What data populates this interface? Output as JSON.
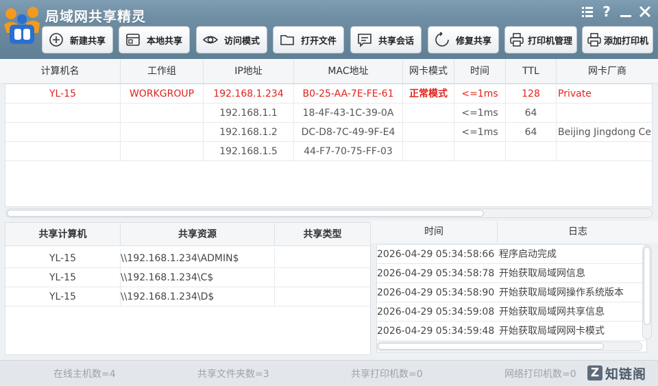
{
  "app": {
    "title": "局域网共享精灵"
  },
  "window_controls": [
    "menu-icon",
    "help-icon",
    "minimize-icon",
    "close-icon"
  ],
  "toolbar": [
    {
      "label": "新建共享",
      "icon": "plus-circle-icon"
    },
    {
      "label": "本地共享",
      "icon": "window-icon"
    },
    {
      "label": "访问模式",
      "icon": "eye-icon"
    },
    {
      "label": "打开文件",
      "icon": "folder-icon"
    },
    {
      "label": "共享会话",
      "icon": "chat-icon"
    },
    {
      "label": "修复共享",
      "icon": "refresh-icon"
    },
    {
      "label": "打印机管理",
      "icon": "printer-icon"
    },
    {
      "label": "添加打印机",
      "icon": "printer-add-icon"
    }
  ],
  "hosts_table": {
    "headers": [
      "计算机名",
      "工作组",
      "IP地址",
      "MAC地址",
      "网卡模式",
      "时间",
      "TTL",
      "网卡厂商"
    ],
    "rows": [
      {
        "computer": "YL-15",
        "workgroup": "WORKGROUP",
        "ip": "192.168.1.234",
        "mac": "B0-25-AA-7E-FE-61",
        "mode": "正常模式",
        "time": "<=1ms",
        "ttl": "128",
        "vendor": "Private",
        "highlight": true
      },
      {
        "computer": "",
        "workgroup": "",
        "ip": "192.168.1.1",
        "mac": "18-4F-43-1C-39-0A",
        "mode": "",
        "time": "<=1ms",
        "ttl": "64",
        "vendor": "",
        "highlight": false
      },
      {
        "computer": "",
        "workgroup": "",
        "ip": "192.168.1.2",
        "mac": "DC-D8-7C-49-9F-E4",
        "mode": "",
        "time": "<=1ms",
        "ttl": "64",
        "vendor": "Beijing Jingdong Ce",
        "highlight": false
      },
      {
        "computer": "",
        "workgroup": "",
        "ip": "192.168.1.5",
        "mac": "44-F7-70-75-FF-03",
        "mode": "",
        "time": "",
        "ttl": "",
        "vendor": "",
        "highlight": false
      }
    ]
  },
  "shares_table": {
    "headers": [
      "共享计算机",
      "共享资源",
      "共享类型"
    ],
    "rows": [
      {
        "computer": "YL-15",
        "resource": "\\\\192.168.1.234\\ADMIN$",
        "type": ""
      },
      {
        "computer": "YL-15",
        "resource": "\\\\192.168.1.234\\C$",
        "type": ""
      },
      {
        "computer": "YL-15",
        "resource": "\\\\192.168.1.234\\D$",
        "type": ""
      }
    ]
  },
  "log_table": {
    "headers": [
      "时间",
      "日志"
    ],
    "rows": [
      {
        "time": "2026-04-29 05:34:58:66",
        "log": "程序启动完成"
      },
      {
        "time": "2026-04-29 05:34:58:78",
        "log": "开始获取局域网信息"
      },
      {
        "time": "2026-04-29 05:34:58:90",
        "log": "开始获取局域网操作系统版本"
      },
      {
        "time": "2026-04-29 05:34:59:08",
        "log": "开始获取局域网共享信息"
      },
      {
        "time": "2026-04-29 05:34:59:48",
        "log": "开始获取局域网网卡模式"
      }
    ]
  },
  "status": {
    "online_hosts": "在线主机数=4",
    "shared_folders": "共享文件夹数=3",
    "shared_printers": "共享打印机数=0",
    "network_printers": "网络打印机数=0"
  },
  "watermark": {
    "badge": "Z",
    "text": "知链阁"
  },
  "colors": {
    "highlight_red": "#e0221b",
    "header_gradient_top": "#7f9db2",
    "header_gradient_bottom": "#5f7f95"
  }
}
